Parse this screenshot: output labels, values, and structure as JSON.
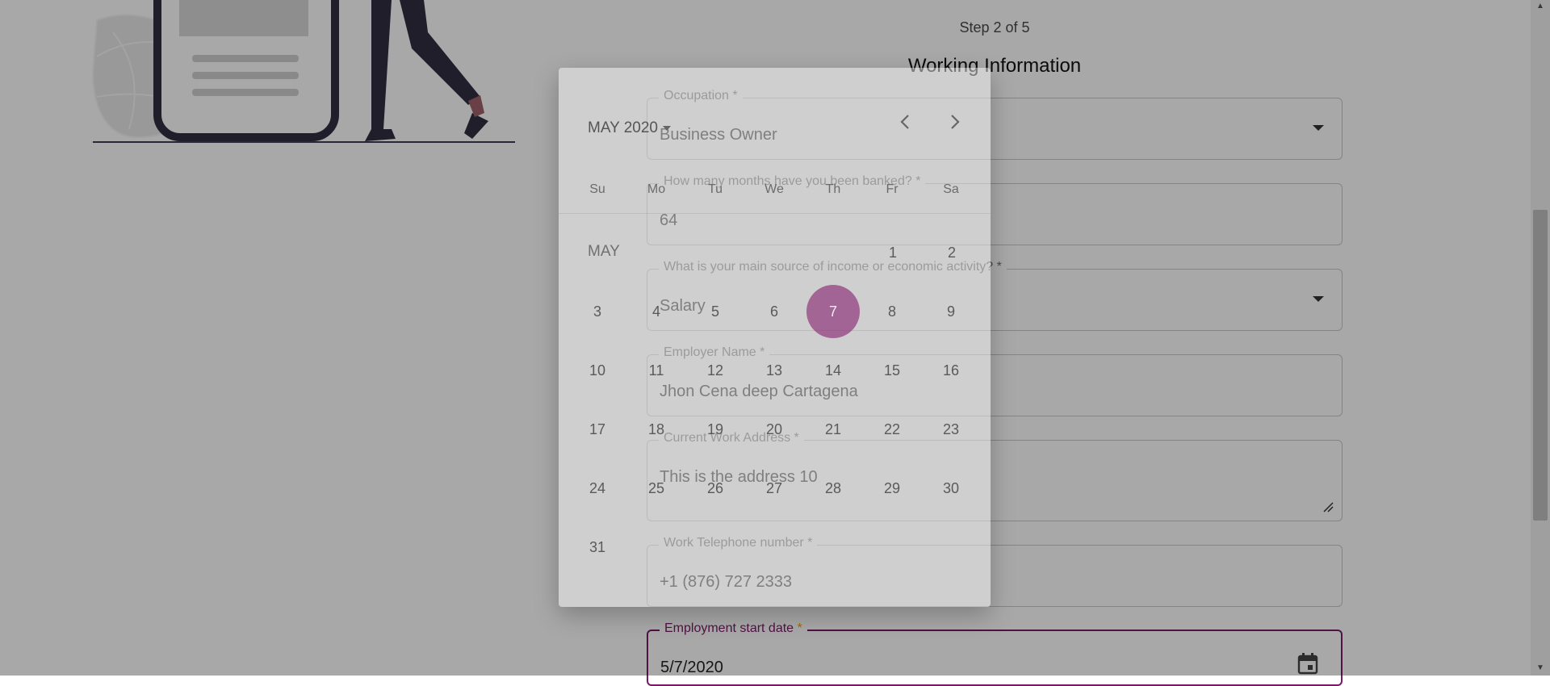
{
  "form": {
    "step": "Step 2 of 5",
    "title": "Working Information",
    "fields": {
      "occupation": {
        "label": "Occupation *",
        "value": "Business Owner"
      },
      "months_banked": {
        "label": "How many months have you been banked? *",
        "value": "64"
      },
      "income_source": {
        "label": "What is your main source of income or economic activity? *",
        "value": "Salary"
      },
      "employer_name": {
        "label": "Employer Name *",
        "value": "Jhon Cena deep Cartagena"
      },
      "work_address": {
        "label": "Current Work Address *",
        "value": "This is the address 10"
      },
      "work_phone": {
        "label": "Work Telephone number *",
        "value": "+1 (876) 727 2333"
      },
      "employment_start": {
        "label": "Employment start date",
        "required_mark": "*",
        "value": "5/7/2020"
      }
    }
  },
  "datepicker": {
    "month_year": "MAY 2020",
    "month_label": "MAY",
    "weekdays": [
      "Su",
      "Mo",
      "Tu",
      "We",
      "Th",
      "Fr",
      "Sa"
    ],
    "days": {
      "d1": "1",
      "d2": "2",
      "d3": "3",
      "d4": "4",
      "d5": "5",
      "d6": "6",
      "d7": "7",
      "d8": "8",
      "d9": "9",
      "d10": "10",
      "d11": "11",
      "d12": "12",
      "d13": "13",
      "d14": "14",
      "d15": "15",
      "d16": "16",
      "d17": "17",
      "d18": "18",
      "d19": "19",
      "d20": "20",
      "d21": "21",
      "d22": "22",
      "d23": "23",
      "d24": "24",
      "d25": "25",
      "d26": "26",
      "d27": "27",
      "d28": "28",
      "d29": "29",
      "d30": "30",
      "d31": "31"
    },
    "selected_day": "7"
  },
  "icons": [
    "dropdown-caret-icon",
    "calendar-icon",
    "chevron-left-icon",
    "chevron-right-icon",
    "resize-handle-icon"
  ],
  "colors": {
    "accent": "#7a1a66",
    "required_star": "#e4a21c",
    "selected_day": "#8a2c75"
  }
}
